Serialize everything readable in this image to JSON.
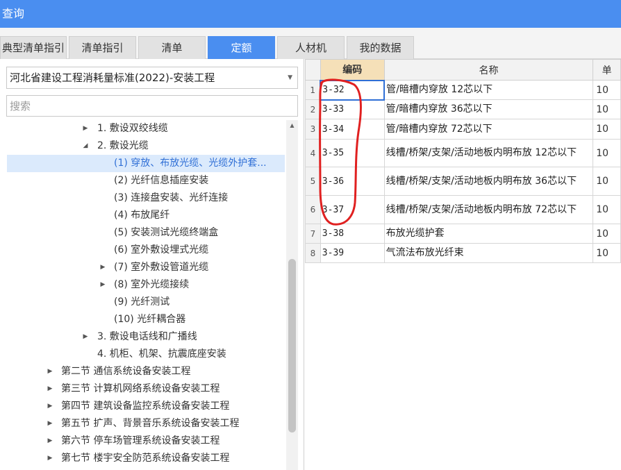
{
  "window": {
    "title": "查询"
  },
  "tabs": [
    {
      "label": "典型清单指引",
      "active": false
    },
    {
      "label": "清单指引",
      "active": false
    },
    {
      "label": "清单",
      "active": false
    },
    {
      "label": "定额",
      "active": true
    },
    {
      "label": "人材机",
      "active": false
    },
    {
      "label": "我的数据",
      "active": false
    }
  ],
  "left": {
    "standard_select": {
      "value": "河北省建设工程消耗量标准(2022)-安装工程"
    },
    "search": {
      "placeholder": "搜索"
    },
    "tree": [
      {
        "label": "1. 敷设双绞线缆",
        "expander": "collapsed",
        "selected": false
      },
      {
        "label": "2. 敷设光缆",
        "expander": "expanded",
        "selected": false
      },
      {
        "label": "(1) 穿放、布放光缆、光缆外护套...",
        "expander": "none",
        "selected": true
      },
      {
        "label": "(2) 光纤信息插座安装",
        "expander": "none",
        "selected": false
      },
      {
        "label": "(3) 连接盘安装、光纤连接",
        "expander": "none",
        "selected": false
      },
      {
        "label": "(4) 布放尾纤",
        "expander": "none",
        "selected": false
      },
      {
        "label": "(5) 安装测试光缆终端盒",
        "expander": "none",
        "selected": false
      },
      {
        "label": "(6) 室外敷设埋式光缆",
        "expander": "none",
        "selected": false
      },
      {
        "label": "(7) 室外敷设管道光缆",
        "expander": "collapsed",
        "selected": false
      },
      {
        "label": "(8) 室外光缆接续",
        "expander": "collapsed",
        "selected": false
      },
      {
        "label": "(9) 光纤测试",
        "expander": "none",
        "selected": false
      },
      {
        "label": "(10) 光纤耦合器",
        "expander": "none",
        "selected": false
      },
      {
        "label": "3. 敷设电话线和广播线",
        "expander": "collapsed",
        "selected": false
      },
      {
        "label": "4. 机柜、机架、抗震底座安装",
        "expander": "none",
        "selected": false
      },
      {
        "label": "第二节 通信系统设备安装工程",
        "expander": "collapsed",
        "selected": false
      },
      {
        "label": "第三节 计算机网络系统设备安装工程",
        "expander": "collapsed",
        "selected": false
      },
      {
        "label": "第四节 建筑设备监控系统设备安装工程",
        "expander": "collapsed",
        "selected": false
      },
      {
        "label": "第五节 扩声、背景音乐系统设备安装工程",
        "expander": "collapsed",
        "selected": false
      },
      {
        "label": "第六节 停车场管理系统设备安装工程",
        "expander": "collapsed",
        "selected": false
      },
      {
        "label": "第七节 楼宇安全防范系统设备安装工程",
        "expander": "collapsed",
        "selected": false
      }
    ]
  },
  "grid": {
    "columns": {
      "code": "编码",
      "name": "名称",
      "unit": "单"
    },
    "rows": [
      {
        "num": "1",
        "code": "3-32",
        "name": "管/暗槽内穿放 12芯以下",
        "unit": "10"
      },
      {
        "num": "2",
        "code": "3-33",
        "name": "管/暗槽内穿放 36芯以下",
        "unit": "10"
      },
      {
        "num": "3",
        "code": "3-34",
        "name": "管/暗槽内穿放 72芯以下",
        "unit": "10"
      },
      {
        "num": "4",
        "code": "3-35",
        "name": "线槽/桥架/支架/活动地板内明布放 12芯以下",
        "unit": "10"
      },
      {
        "num": "5",
        "code": "3-36",
        "name": "线槽/桥架/支架/活动地板内明布放 36芯以下",
        "unit": "10"
      },
      {
        "num": "6",
        "code": "3-37",
        "name": "线槽/桥架/支架/活动地板内明布放 72芯以下",
        "unit": "10"
      },
      {
        "num": "7",
        "code": "3-38",
        "name": "布放光缆护套",
        "unit": "10"
      },
      {
        "num": "8",
        "code": "3-39",
        "name": "气流法布放光纤束",
        "unit": "10"
      }
    ]
  },
  "colors": {
    "accent": "#4a8ef0",
    "selected_bg": "#dbeafc",
    "code_header_bg": "#f5e0b8",
    "annotation": "#e02020"
  },
  "icons": {
    "dropdown": "caret-down-icon",
    "expander_collapsed": "triangle-right-icon",
    "expander_expanded": "triangle-down-icon",
    "scroll_up": "scroll-up-icon"
  }
}
